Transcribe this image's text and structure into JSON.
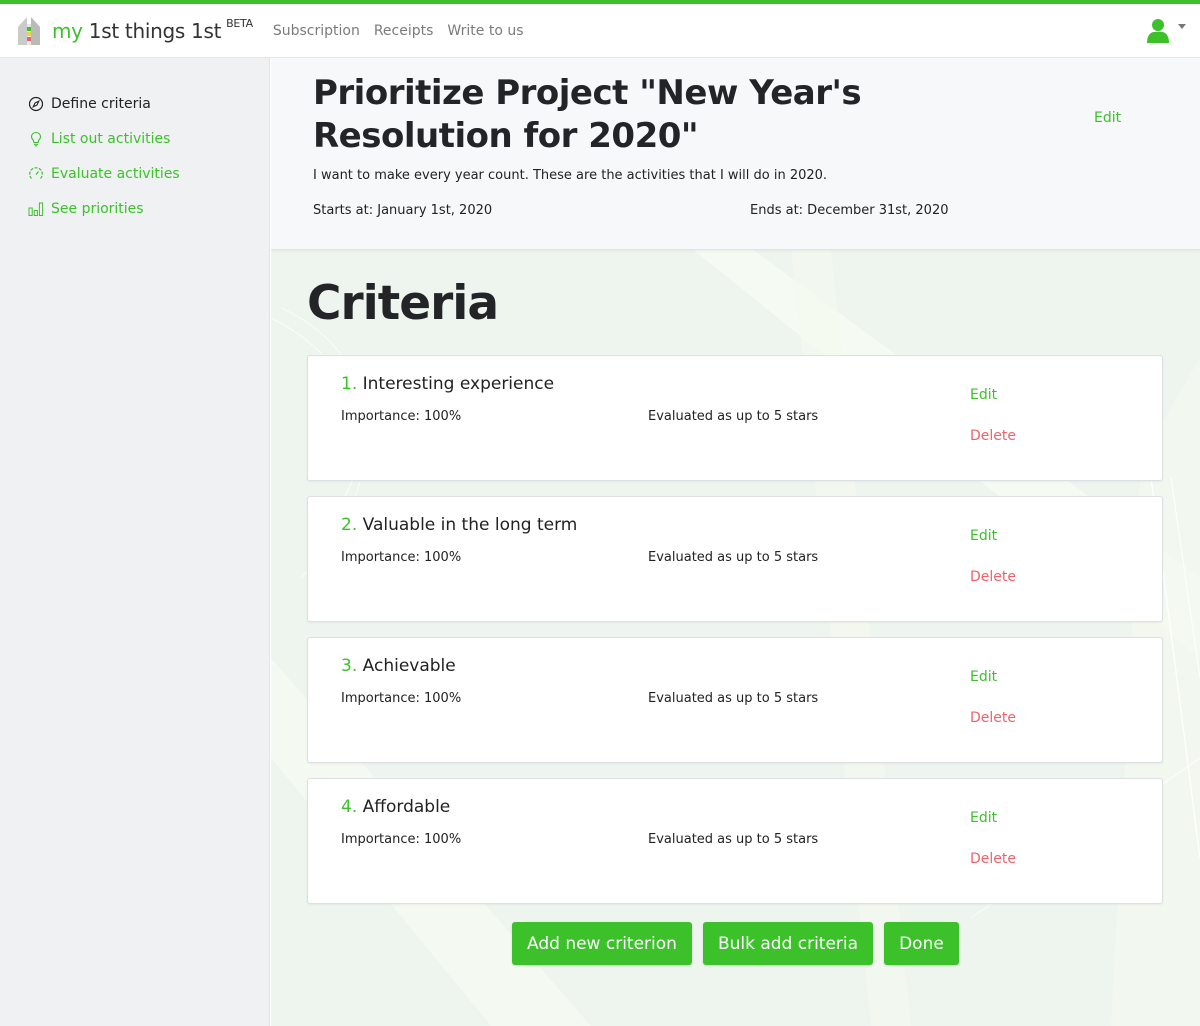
{
  "theme": {
    "accent": "#3cc12b",
    "danger": "#f0616a",
    "text": "#222428"
  },
  "navbar": {
    "brand_my": "my",
    "brand_rest": " 1st things 1st",
    "brand_badge": "BETA",
    "links": [
      {
        "label": "Subscription"
      },
      {
        "label": "Receipts"
      },
      {
        "label": "Write to us"
      }
    ],
    "user_icon": "user-icon"
  },
  "sidebar": {
    "items": [
      {
        "label": "Define criteria",
        "icon": "compass-icon",
        "active": true
      },
      {
        "label": "List out activities",
        "icon": "lightbulb-icon",
        "active": false
      },
      {
        "label": "Evaluate activities",
        "icon": "gauge-icon",
        "active": false
      },
      {
        "label": "See priorities",
        "icon": "bar-chart-icon",
        "active": false
      }
    ]
  },
  "project": {
    "title": "Prioritize Project \"New Year's Resolution for 2020\"",
    "edit_label": "Edit",
    "description": "I want to make every year count. These are the activities that I will do in 2020.",
    "starts": "Starts at: January 1st, 2020",
    "ends": "Ends at: December 31st, 2020"
  },
  "criteria": {
    "section_title": "Criteria",
    "items": [
      {
        "number": "1.",
        "name": "Interesting experience",
        "importance": "Importance: 100%",
        "evaluation": "Evaluated as up to 5 stars",
        "edit_label": "Edit",
        "delete_label": "Delete"
      },
      {
        "number": "2.",
        "name": "Valuable in the long term",
        "importance": "Importance: 100%",
        "evaluation": "Evaluated as up to 5 stars",
        "edit_label": "Edit",
        "delete_label": "Delete"
      },
      {
        "number": "3.",
        "name": "Achievable",
        "importance": "Importance: 100%",
        "evaluation": "Evaluated as up to 5 stars",
        "edit_label": "Edit",
        "delete_label": "Delete"
      },
      {
        "number": "4.",
        "name": "Affordable",
        "importance": "Importance: 100%",
        "evaluation": "Evaluated as up to 5 stars",
        "edit_label": "Edit",
        "delete_label": "Delete"
      }
    ]
  },
  "actions": {
    "add_label": "Add new criterion",
    "bulk_label": "Bulk add criteria",
    "done_label": "Done"
  }
}
